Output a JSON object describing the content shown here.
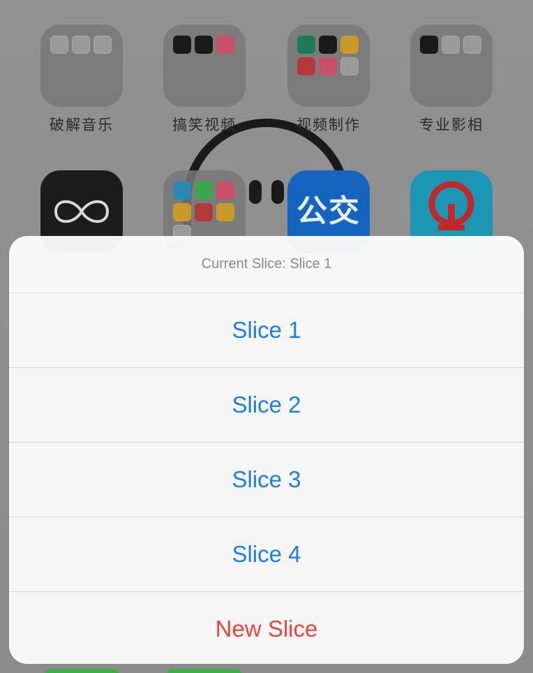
{
  "home": {
    "row1": [
      {
        "label": "破解音乐",
        "kind": "folder"
      },
      {
        "label": "搞笑视频",
        "kind": "folder"
      },
      {
        "label": "视频制作",
        "kind": "folder"
      },
      {
        "label": "专业影相",
        "kind": "folder"
      }
    ],
    "row2_icons": [
      "infinity-app-icon",
      "video-folder-icon",
      "bus-app-icon",
      "railway-app-icon"
    ],
    "bus_tile_text": "公交"
  },
  "action_sheet": {
    "title": "Current Slice: Slice 1",
    "items": [
      {
        "label": "Slice 1",
        "style": "default"
      },
      {
        "label": "Slice 2",
        "style": "default"
      },
      {
        "label": "Slice 3",
        "style": "default"
      },
      {
        "label": "Slice 4",
        "style": "default"
      },
      {
        "label": "New Slice",
        "style": "destructive"
      }
    ]
  },
  "colors": {
    "action_blue": "#1a7fe6",
    "destructive_red": "#f0443a",
    "header_gray": "#8a8a8f"
  }
}
